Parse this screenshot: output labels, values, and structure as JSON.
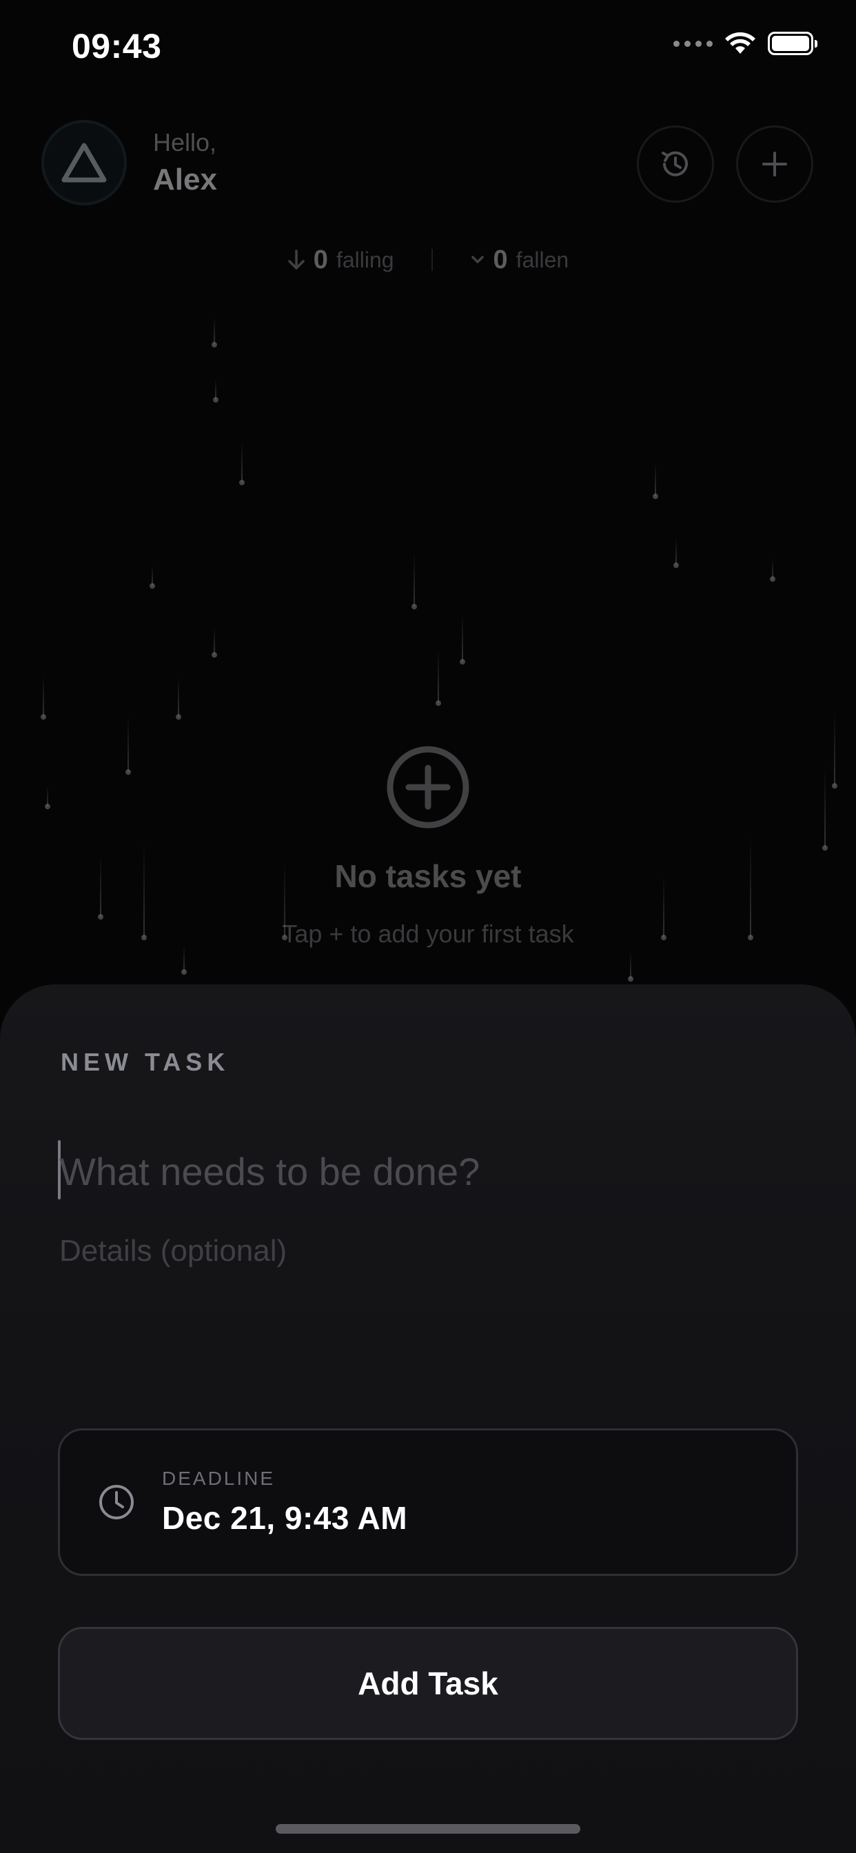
{
  "status_bar": {
    "time": "09:43"
  },
  "header": {
    "greeting": "Hello,",
    "user_name": "Alex",
    "avatar_icon": "triangle-logo-icon",
    "history_icon": "history-icon",
    "add_icon": "plus-icon"
  },
  "stats": {
    "falling_count": "0",
    "falling_label": "falling",
    "fallen_count": "0",
    "fallen_label": "fallen"
  },
  "empty_state": {
    "icon": "plus-circle-icon",
    "title": "No tasks yet",
    "subtitle": "Tap + to add your first task"
  },
  "sheet": {
    "title": "NEW TASK",
    "task_placeholder": "What needs to be done?",
    "task_value": "",
    "details_placeholder": "Details (optional)",
    "details_value": "",
    "deadline_label": "DEADLINE",
    "deadline_value": "Dec 21, 9:43 AM",
    "submit_label": "Add Task"
  }
}
